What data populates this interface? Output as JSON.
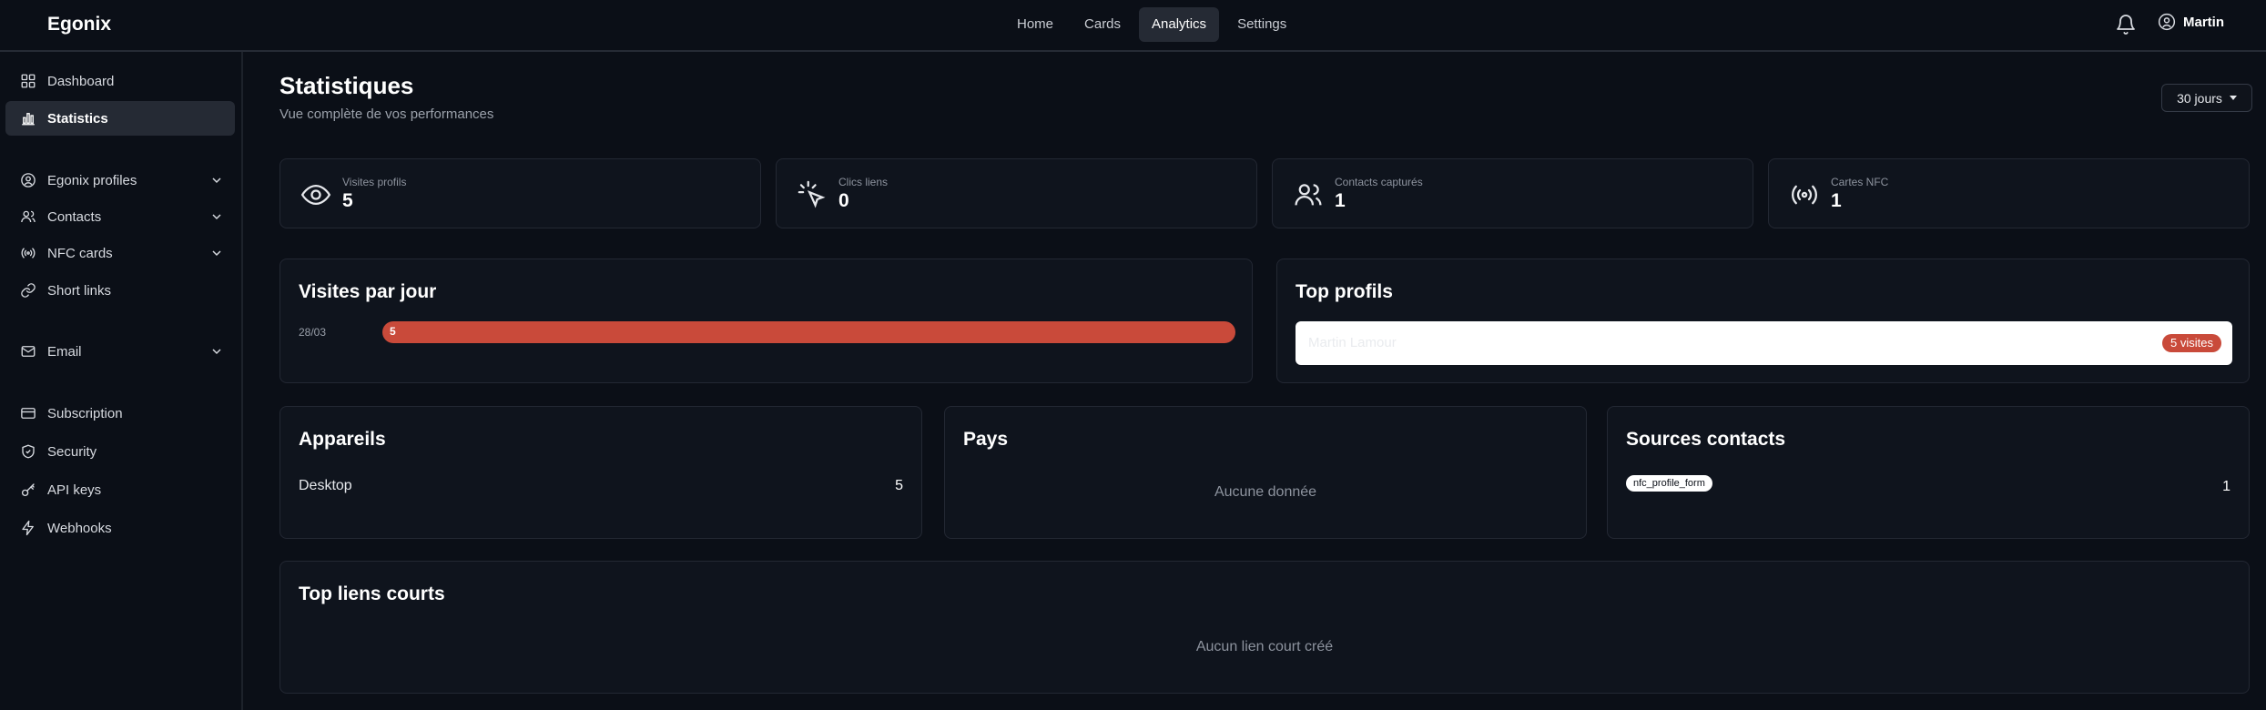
{
  "app": {
    "brand": "Egonix",
    "user_name": "Martin"
  },
  "topnav": [
    {
      "label": "Home",
      "active": false
    },
    {
      "label": "Cards",
      "active": false
    },
    {
      "label": "Analytics",
      "active": true
    },
    {
      "label": "Settings",
      "active": false
    }
  ],
  "sidebar": {
    "items": [
      {
        "label": "Dashboard",
        "icon": "grid-icon"
      },
      {
        "label": "Statistics",
        "icon": "bar-chart-icon",
        "active": true
      },
      {
        "label": "Egonix profiles",
        "icon": "user-circle-icon"
      },
      {
        "label": "Contacts",
        "icon": "users-icon"
      },
      {
        "label": "NFC cards",
        "icon": "nfc-icon"
      },
      {
        "label": "Short links",
        "icon": "link-icon"
      },
      {
        "label": "Email",
        "icon": "mail-icon"
      },
      {
        "label": "Subscription",
        "icon": "credit-card-icon"
      },
      {
        "label": "Security",
        "icon": "shield-icon"
      },
      {
        "label": "API keys",
        "icon": "key-icon"
      },
      {
        "label": "Webhooks",
        "icon": "bolt-icon"
      }
    ]
  },
  "page": {
    "title": "Statistiques",
    "subtitle": "Vue complète de vos performances",
    "period": "30 jours"
  },
  "stats": [
    {
      "label": "Visites profils",
      "value": "5",
      "icon": "eye-icon"
    },
    {
      "label": "Clics liens",
      "value": "0",
      "icon": "cursor-click-icon"
    },
    {
      "label": "Contacts capturés",
      "value": "1",
      "icon": "users-icon"
    },
    {
      "label": "Cartes NFC",
      "value": "1",
      "icon": "nfc-icon"
    }
  ],
  "visits_per_day": {
    "title": "Visites par jour",
    "rows": [
      {
        "date": "28/03",
        "value": "5",
        "fraction": 1.0
      }
    ]
  },
  "top_profiles": {
    "title": "Top profils",
    "rows": [
      {
        "name": "Martin Lamour",
        "badge": "5 visites"
      }
    ]
  },
  "devices": {
    "title": "Appareils",
    "rows": [
      {
        "label": "Desktop",
        "value": "5"
      }
    ]
  },
  "countries": {
    "title": "Pays",
    "empty": "Aucune donnée"
  },
  "contact_sources": {
    "title": "Sources contacts",
    "rows": [
      {
        "label": "nfc_profile_form",
        "value": "1"
      }
    ]
  },
  "top_short_links": {
    "title": "Top liens courts",
    "empty": "Aucun lien court créé"
  },
  "colors": {
    "accent": "#c94a3a",
    "background": "#0b0f17",
    "card": "#0f141d"
  }
}
